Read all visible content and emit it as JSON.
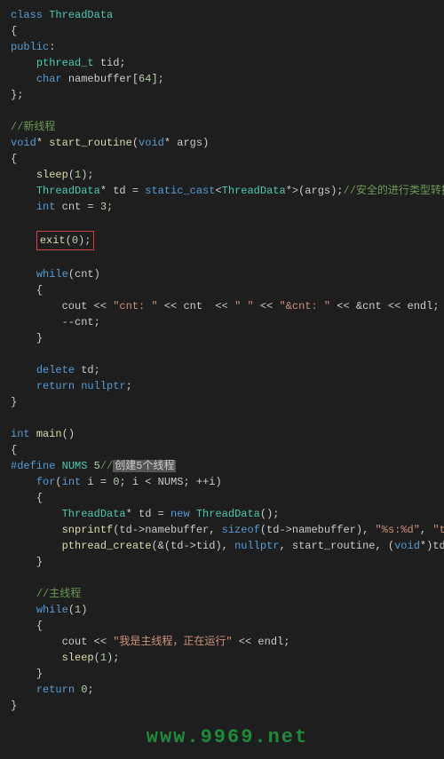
{
  "lines": {
    "l1a": "class",
    "l1b": "ThreadData",
    "l2": "{",
    "l3a": "public",
    "l3b": ":",
    "l4a": "pthread_t",
    "l4b": " tid;",
    "l5a": "char",
    "l5b": " namebuffer[",
    "l5c": "64",
    "l5d": "];",
    "l6": "};",
    "c1": "//新线程",
    "l7a": "void",
    "l7b": "* ",
    "l7c": "start_routine",
    "l7d": "(",
    "l7e": "void",
    "l7f": "* args)",
    "l8": "{",
    "l9a": "sleep",
    "l9b": "(",
    "l9c": "1",
    "l9d": ");",
    "l10a": "ThreadData",
    "l10b": "* td = ",
    "l10c": "static_cast",
    "l10d": "<",
    "l10e": "ThreadData",
    "l10f": "*>(args);",
    "l10g": "//安全的进行类型转换",
    "l11a": "int",
    "l11b": " cnt = ",
    "l11c": "3",
    "l11d": ";",
    "l12a": "exit",
    "l12b": "(",
    "l12c": "0",
    "l12d": ");",
    "l13a": "while",
    "l13b": "(cnt)",
    "l14": "{",
    "l15a": "cout << ",
    "l15b": "\"cnt: \"",
    "l15c": " << cnt  << ",
    "l15d": "\" \"",
    "l15e": " << ",
    "l15f": "\"&cnt: \"",
    "l15g": " << &cnt << endl;",
    "l16": "--cnt;",
    "l17": "}",
    "l18a": "delete",
    "l18b": " td;",
    "l19a": "return",
    "l19b": " ",
    "l19c": "nullptr",
    "l19d": ";",
    "l20": "}",
    "l21a": "int",
    "l21b": " ",
    "l21c": "main",
    "l21d": "()",
    "l22": "{",
    "l23a": "#define",
    "l23b": " ",
    "l23c": "NUMS",
    "l23d": " ",
    "l23e": "5",
    "l23f": "//",
    "l23g": "创建5个线程",
    "l24a": "for",
    "l24b": "(",
    "l24c": "int",
    "l24d": " i = ",
    "l24e": "0",
    "l24f": "; i < NUMS; ++i)",
    "l25": "{",
    "l26a": "ThreadData",
    "l26b": "* td = ",
    "l26c": "new",
    "l26d": " ",
    "l26e": "ThreadData",
    "l26f": "();",
    "l27a": "snprintf",
    "l27b": "(td->namebuffer, ",
    "l27c": "sizeof",
    "l27d": "(td->namebuffer), ",
    "l27e": "\"%s:%d\"",
    "l27f": ", ",
    "l27g": "\"thread",
    "l28a": "pthread_create",
    "l28b": "(&(td->tid), ",
    "l28c": "nullptr",
    "l28d": ", start_routine, (",
    "l28e": "void",
    "l28f": "*)td);",
    "l29": "}",
    "c2": "//主线程",
    "l30a": "while",
    "l30b": "(",
    "l30c": "1",
    "l30d": ")",
    "l31": "{",
    "l32a": "cout << ",
    "l32b": "\"我是主线程，正在运行\"",
    "l32c": " << endl;",
    "l33a": "sleep",
    "l33b": "(",
    "l33c": "1",
    "l33d": ");",
    "l34": "}",
    "l35a": "return",
    "l35b": " ",
    "l35c": "0",
    "l35d": ";",
    "l36": "}"
  },
  "watermark": "www.9969.net"
}
